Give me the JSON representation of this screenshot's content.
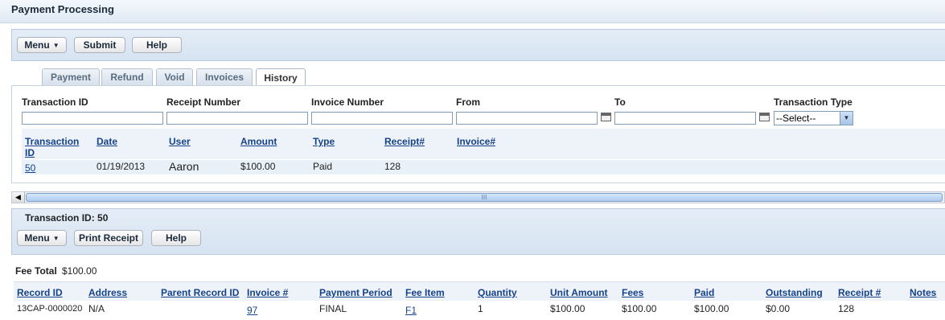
{
  "window": {
    "title": "Payment Processing"
  },
  "toolbar": {
    "menu_label": "Menu",
    "submit_label": "Submit",
    "help_label": "Help"
  },
  "tabs": [
    {
      "label": "Payment"
    },
    {
      "label": "Refund"
    },
    {
      "label": "Void"
    },
    {
      "label": "Invoices"
    },
    {
      "label": "History",
      "active": true
    }
  ],
  "filters": {
    "transaction_id_label": "Transaction ID",
    "receipt_number_label": "Receipt Number",
    "invoice_number_label": "Invoice Number",
    "from_label": "From",
    "to_label": "To",
    "transaction_type_label": "Transaction Type",
    "transaction_type_value": "--Select--"
  },
  "history": {
    "columns": [
      "Transaction ID",
      "Date",
      "User",
      "Amount",
      "Type",
      "Receipt#",
      "Invoice#"
    ],
    "rows": [
      {
        "transaction_id": "50",
        "date": "01/19/2013",
        "user": "Aaron",
        "amount": "$100.00",
        "type": "Paid",
        "receipt": "128",
        "invoice": ""
      }
    ]
  },
  "scrollbar": {
    "grip": "III"
  },
  "detail": {
    "title": "Transaction ID: 50",
    "menu_label": "Menu",
    "print_receipt_label": "Print Receipt",
    "help_label": "Help",
    "fee_total_label": "Fee Total",
    "fee_total_value": "$100.00"
  },
  "fees": {
    "columns": [
      "Record ID",
      "Address",
      "Parent Record ID",
      "Invoice #",
      "Payment Period",
      "Fee Item",
      "Quantity",
      "Unit Amount",
      "Fees",
      "Paid",
      "Outstanding",
      "Receipt #",
      "Notes"
    ],
    "rows": [
      {
        "record_id": "13CAP-0000020",
        "address": "N/A",
        "parent_record_id": "",
        "invoice": "97",
        "payment_period": "FINAL",
        "fee_item": "F1",
        "quantity": "1",
        "unit_amount": "$100.00",
        "fees": "$100.00",
        "paid": "$100.00",
        "outstanding": "$0.00",
        "receipt": "128",
        "notes": ""
      }
    ]
  },
  "colors": {
    "link": "#15428b",
    "panel": "#dde8f4",
    "row_highlight": "#e8f0f8"
  }
}
